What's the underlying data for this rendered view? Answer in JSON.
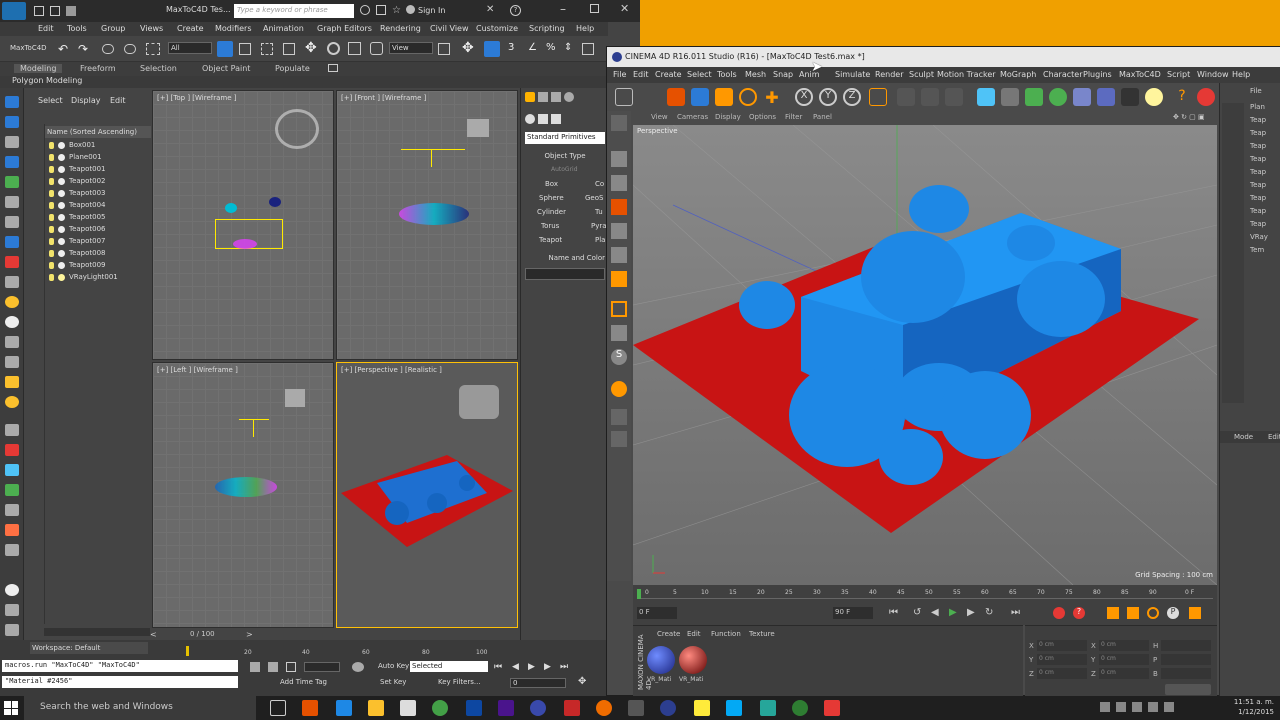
{
  "max": {
    "title": "MaxToC4D Tes...",
    "search_placeholder": "Type a keyword or phrase",
    "signin": "Sign In",
    "menu": [
      "Edit",
      "Tools",
      "Group",
      "Views",
      "Create",
      "Modifiers",
      "Animation",
      "Graph Editors",
      "Rendering",
      "Civil View",
      "Customize",
      "Scripting",
      "Help"
    ],
    "toolbar_label": "MaxToC4D",
    "filter_value": "All",
    "view_value": "View",
    "ribbon_tabs": [
      "Modeling",
      "Freeform",
      "Selection",
      "Object Paint",
      "Populate"
    ],
    "ribbon_sub": "Polygon Modeling",
    "explorer_menu": [
      "Select",
      "Display",
      "Edit"
    ],
    "explorer_header": "Name (Sorted Ascending)",
    "explorer_items": [
      "Box001",
      "Plane001",
      "Teapot001",
      "Teapot002",
      "Teapot003",
      "Teapot004",
      "Teapot005",
      "Teapot006",
      "Teapot007",
      "Teapot008",
      "Teapot009",
      "VRayLight001"
    ],
    "viewports": [
      "[+] [Top ] [Wireframe ]",
      "[+] [Front ] [Wireframe ]",
      "[+] [Left ] [Wireframe ]",
      "[+] [Perspective ] [Realistic ]"
    ],
    "cmd_dropdown": "Standard Primitives",
    "cmd_section": "Object Type",
    "cmd_autogrid": "AutoGrid",
    "cmd_buttons": [
      [
        "Box",
        "Co"
      ],
      [
        "Sphere",
        "GeoS"
      ],
      [
        "Cylinder",
        "Tu"
      ],
      [
        "Torus",
        "Pyra"
      ],
      [
        "Teapot",
        "Pla"
      ]
    ],
    "cmd_section2": "Name and Color",
    "frame_counter": "0 / 100",
    "timeline_ticks": [
      "20",
      "40",
      "60",
      "80",
      "100"
    ],
    "workspace": "Workspace: Default",
    "script_line1": "macros.run \"MaxToC4D\" \"MaxToC4D\"",
    "script_line2": "\"Material #2456\"",
    "autokey": "Auto Key",
    "selected": "Selected",
    "setkey": "Set Key",
    "keyfilters": "Key Filters...",
    "add_time_tag": "Add Time Tag",
    "frame_value": "0"
  },
  "c4d": {
    "title": "CINEMA 4D R16.011 Studio (R16) - [MaxToC4D Test6.max *]",
    "menu": [
      "File",
      "Edit",
      "Create",
      "Select",
      "Tools",
      "Mesh",
      "Snap",
      "Anim",
      "Simulate",
      "Render",
      "Sculpt",
      "Motion Tracker",
      "MoGraph",
      "Character",
      "Plugins",
      "MaxToC4D",
      "Script",
      "Window",
      "Help"
    ],
    "vp_menu": [
      "View",
      "Cameras",
      "Display",
      "Options",
      "Filter",
      "Panel"
    ],
    "vp_label": "Perspective",
    "grid_spacing": "Grid Spacing : 100 cm",
    "timeline_ticks": [
      "0",
      "5",
      "10",
      "15",
      "20",
      "25",
      "30",
      "35",
      "40",
      "45",
      "50",
      "55",
      "60",
      "65",
      "70",
      "75",
      "80",
      "85",
      "90"
    ],
    "frame_end": "0 F",
    "field_start": "0 F",
    "field_end": "90 F",
    "mat_menu": [
      "Create",
      "Edit",
      "Function",
      "Texture"
    ],
    "materials": [
      "VR_Mati",
      "VR_Mati"
    ],
    "coord_labels": [
      "X",
      "Y",
      "Z"
    ],
    "coord_labels2": [
      "X",
      "Y",
      "Z"
    ],
    "coord_labels3": [
      "H",
      "P",
      "B"
    ],
    "coord_value": "0 cm",
    "right_panel_header": "File",
    "right_items": [
      "Plan",
      "Teap",
      "Teap",
      "Teap",
      "Teap",
      "Teap",
      "Teap",
      "Teap",
      "Teap",
      "Teap",
      "VRay",
      "Tem"
    ],
    "attr_header": "Mode",
    "attr_header2": "Edit",
    "maxon_label": "MAXON CINEMA 4D"
  },
  "taskbar": {
    "search": "Search the web and Windows",
    "time": "11:51 a. m.",
    "date": "1/12/2015"
  },
  "colors": {
    "accent_orange": "#f0a000",
    "model_blue": "#1e88e5",
    "plane_red": "#c81414"
  }
}
